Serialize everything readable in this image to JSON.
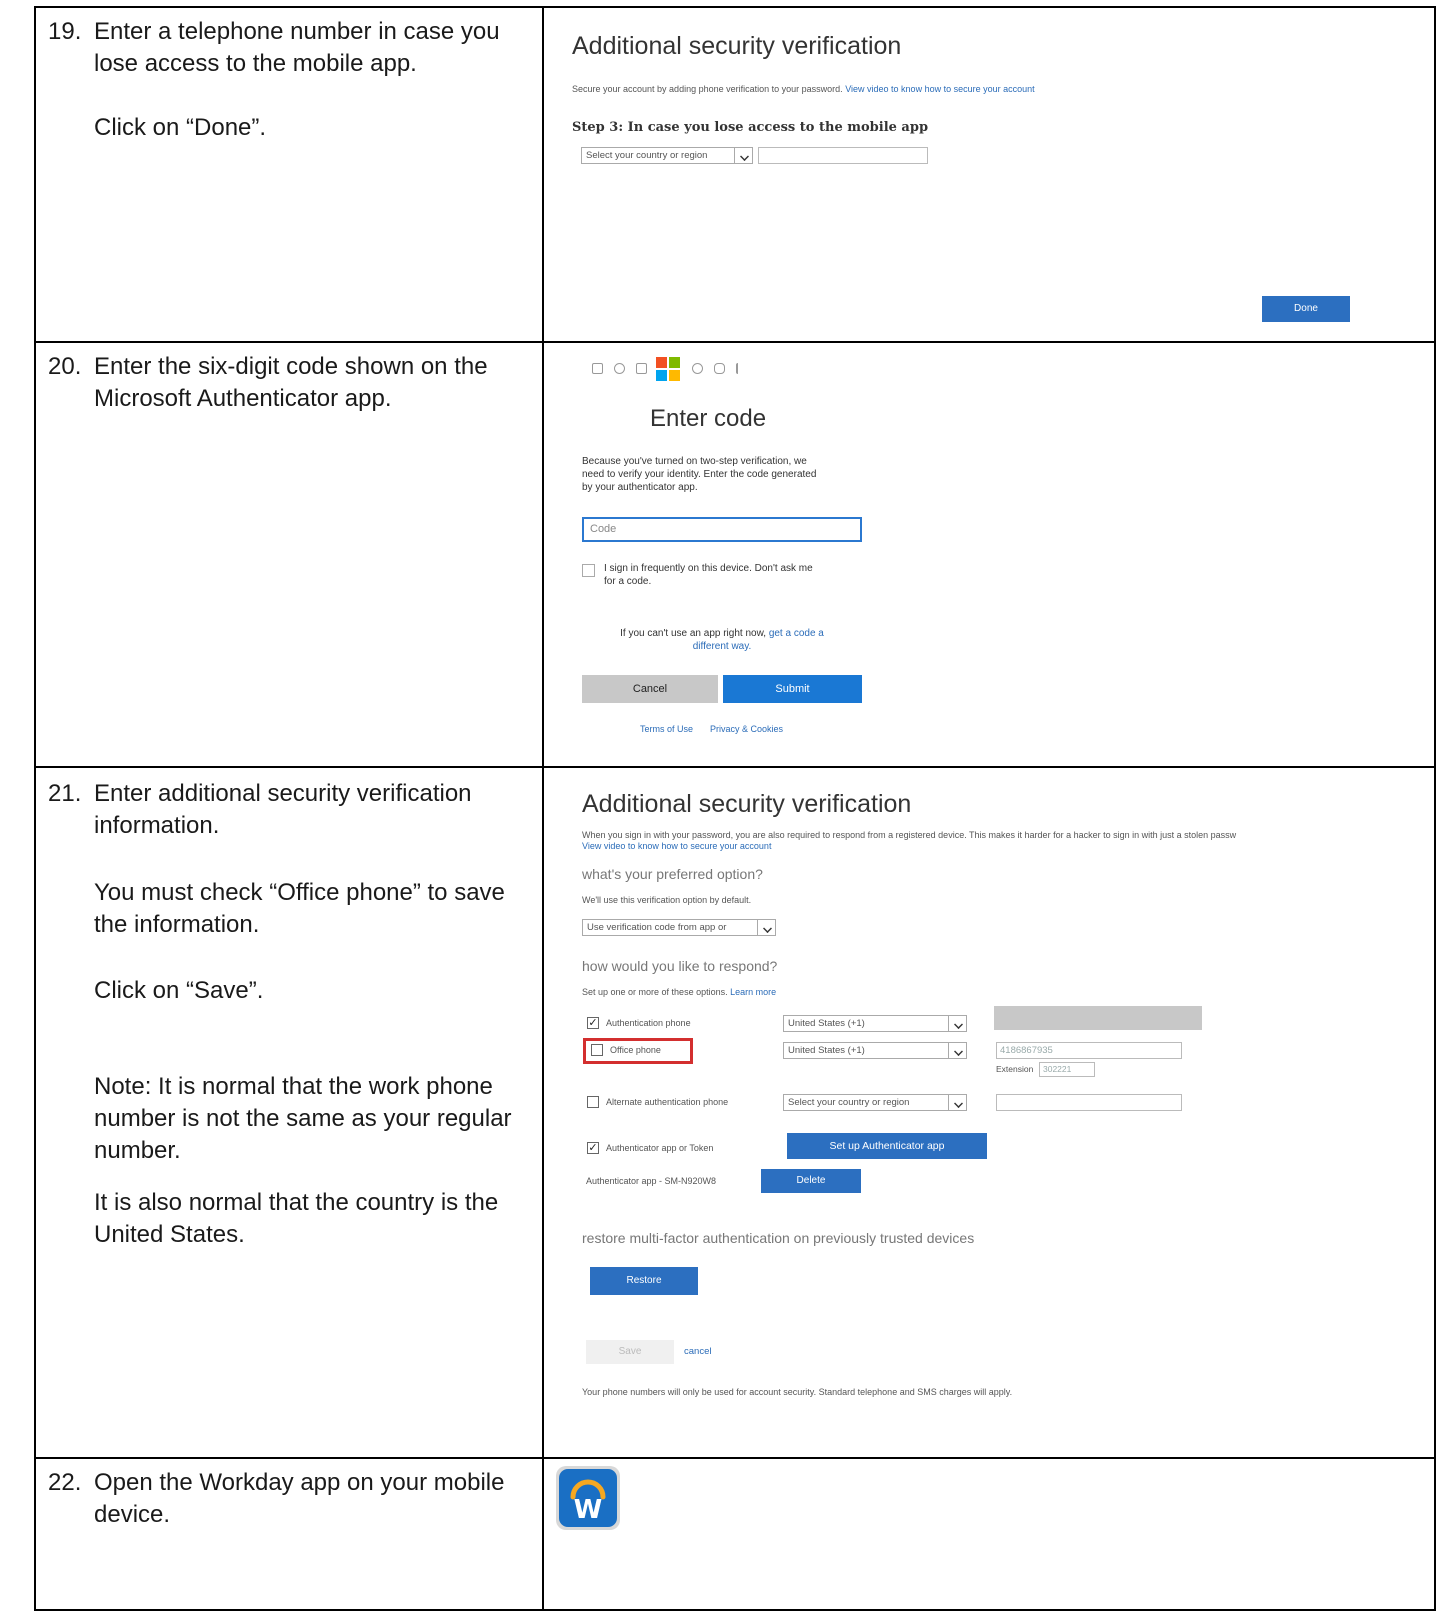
{
  "steps": [
    {
      "number": "19.",
      "lines": [
        "Enter a telephone number in case you",
        "lose access to the mobile app.",
        "Click on “Done”."
      ]
    },
    {
      "number": "20.",
      "lines": [
        "Enter the six-digit code shown on the",
        "Microsoft Authenticator app."
      ]
    },
    {
      "number": "21.",
      "lines": [
        "Enter additional security verification",
        "information.",
        "You must check “Office phone” to save",
        "the information.",
        "Click on “Save”.",
        "Note: It is normal that the work phone",
        "number is not the same as your regular",
        "number.",
        "It is also normal that the country is the",
        "United States."
      ]
    },
    {
      "number": "22.",
      "lines": [
        "Open the Workday app on your mobile",
        "device."
      ]
    }
  ],
  "shot19": {
    "title": "Additional security verification",
    "subtitle_text": "Secure your account by adding phone verification to your password.",
    "subtitle_link": "View video to know how to secure your account",
    "step_heading": "Step 3: In case you lose access to the mobile app",
    "country_select": "Select your country or region",
    "done_label": "Done"
  },
  "shot20": {
    "title": "Enter code",
    "description": [
      "Because you've turned on two-step verification, we",
      "need to verify your identity. Enter the code generated",
      "by your authenticator app."
    ],
    "code_placeholder": "Code",
    "remember_label": [
      "I sign in frequently on this device. Don't ask me",
      "for a code."
    ],
    "alt_text": "If you can't use an app right now,",
    "alt_link_1": "get a code a",
    "alt_link_2": "different way.",
    "cancel_label": "Cancel",
    "submit_label": "Submit",
    "terms_label": "Terms of Use",
    "privacy_label": "Privacy & Cookies",
    "brand_colors": {
      "red": "#f25022",
      "green": "#7fba00",
      "blue": "#00a4ef",
      "yellow": "#ffb900"
    }
  },
  "shot21": {
    "title": "Additional security verification",
    "intro_text": "When you sign in with your password, you are also required to respond from a registered device. This makes it harder for a hacker to sign in with just a stolen passw",
    "intro_link": "View video to know how to secure your account",
    "preferred_heading": "what's your preferred option?",
    "preferred_note": "We'll use this verification option by default.",
    "preferred_select": "Use verification code from app or",
    "respond_heading": "how would you like to respond?",
    "respond_note": "Set up one or more of these options.",
    "learn_more": "Learn more",
    "auth_phone_label": "Authentication phone",
    "auth_phone_country": "United States (+1)",
    "office_phone_label": "Office phone",
    "office_phone_country": "United States (+1)",
    "office_phone_number": "4186867935",
    "extension_label": "Extension",
    "extension_value": "302221",
    "alt_phone_label": "Alternate authentication phone",
    "alt_phone_country": "Select your country or region",
    "auth_app_label": "Authenticator app or Token",
    "setup_app_label": "Set up Authenticator app",
    "device_label": "Authenticator app - SM-N920W8",
    "delete_label": "Delete",
    "restore_heading": "restore multi-factor authentication on previously trusted devices",
    "restore_label": "Restore",
    "save_label": "Save",
    "cancel_label": "cancel",
    "footer_note": "Your phone numbers will only be used for account security. Standard telephone and SMS charges will apply.",
    "highlight_color": "#d32f2f"
  },
  "shot22": {
    "app_letter": "W",
    "icon_bg": "#1a6fc4",
    "arc_color": "#f6a821"
  }
}
